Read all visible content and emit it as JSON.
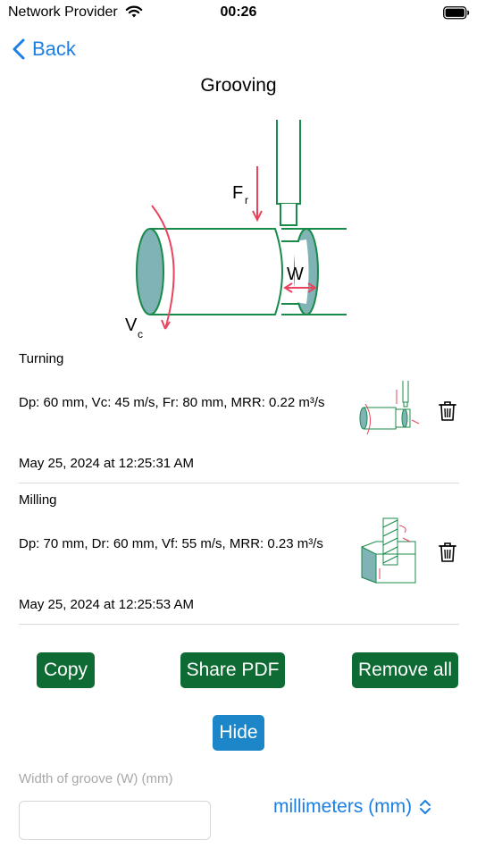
{
  "status_bar": {
    "carrier": "Network Provider",
    "time": "00:26"
  },
  "nav": {
    "back_label": "Back"
  },
  "page": {
    "title": "Grooving"
  },
  "diagram": {
    "force_label": "F",
    "force_sub": "r",
    "width_label": "W",
    "speed_label": "V",
    "speed_sub": "c"
  },
  "history": [
    {
      "name": "Turning",
      "values": "Dp: 60 mm,  Vc: 45 m/s, Fr: 80 mm, MRR: 0.22 m³/s",
      "date": "May 25, 2024 at 12:25:31 AM"
    },
    {
      "name": "Milling",
      "values": "Dp: 70 mm,  Dr: 60 mm, Vf: 55 m/s, MRR: 0.23 m³/s",
      "date": "May 25, 2024 at 12:25:53 AM"
    }
  ],
  "actions": {
    "copy": "Copy",
    "share_pdf": "Share PDF",
    "remove_all": "Remove all",
    "hide": "Hide"
  },
  "input": {
    "label": "Width of groove (W) (mm)",
    "value": "",
    "unit": "millimeters (mm)"
  },
  "colors": {
    "accent_blue": "#1c7fe3",
    "button_green": "#0e6b33",
    "button_blue": "#1c86c8",
    "diagram_green": "#1a8a4a",
    "diagram_fill": "#7fb3b5",
    "arrow_red": "#e8445f"
  }
}
